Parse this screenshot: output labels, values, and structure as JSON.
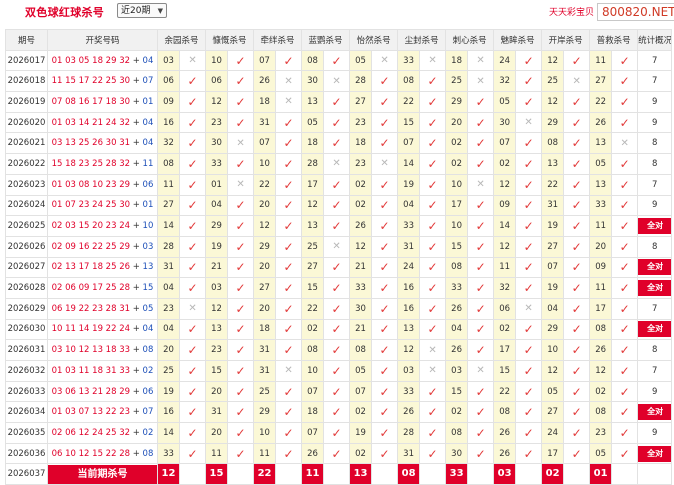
{
  "header": {
    "title": "双色球红球杀号",
    "period_select": "近20期",
    "brand": "天天彩宝贝",
    "watermark": "800820.NET"
  },
  "columns": [
    "期号",
    "开奖号码",
    "余园杀号",
    "慷慨杀号",
    "牵绊杀号",
    "蓝鹦杀号",
    "怡然杀号",
    "尘封杀号",
    "刺心杀号",
    "魅眸杀号",
    "开岸杀号",
    "普救杀号",
    "统计概况"
  ],
  "rows": [
    {
      "issue": "2026017",
      "red": "01 03 05 18 29 32",
      "blue": "04",
      "kills": [
        [
          "03",
          0
        ],
        [
          "10",
          1
        ],
        [
          "07",
          1
        ],
        [
          "08",
          1
        ],
        [
          "05",
          0
        ],
        [
          "33",
          0
        ],
        [
          "18",
          0
        ],
        [
          "24",
          1
        ],
        [
          "12",
          1
        ],
        [
          "11",
          1
        ]
      ],
      "stat": "7"
    },
    {
      "issue": "2026018",
      "red": "11 15 17 22 25 30",
      "blue": "07",
      "kills": [
        [
          "06",
          1
        ],
        [
          "06",
          1
        ],
        [
          "26",
          0
        ],
        [
          "30",
          0
        ],
        [
          "28",
          1
        ],
        [
          "08",
          1
        ],
        [
          "25",
          0
        ],
        [
          "32",
          1
        ],
        [
          "25",
          0
        ],
        [
          "27",
          1
        ]
      ],
      "stat": "7"
    },
    {
      "issue": "2026019",
      "red": "07 08 16 17 18 30",
      "blue": "01",
      "kills": [
        [
          "09",
          1
        ],
        [
          "12",
          1
        ],
        [
          "18",
          0
        ],
        [
          "13",
          1
        ],
        [
          "27",
          1
        ],
        [
          "22",
          1
        ],
        [
          "29",
          1
        ],
        [
          "05",
          1
        ],
        [
          "12",
          1
        ],
        [
          "22",
          1
        ]
      ],
      "stat": "9"
    },
    {
      "issue": "2026020",
      "red": "01 03 14 21 24 32",
      "blue": "04",
      "kills": [
        [
          "16",
          1
        ],
        [
          "23",
          1
        ],
        [
          "31",
          1
        ],
        [
          "05",
          1
        ],
        [
          "23",
          1
        ],
        [
          "15",
          1
        ],
        [
          "20",
          1
        ],
        [
          "30",
          0
        ],
        [
          "29",
          1
        ],
        [
          "26",
          1
        ]
      ],
      "stat": "9"
    },
    {
      "issue": "2026021",
      "red": "03 13 25 26 30 31",
      "blue": "04",
      "kills": [
        [
          "32",
          1
        ],
        [
          "30",
          0
        ],
        [
          "07",
          1
        ],
        [
          "18",
          1
        ],
        [
          "18",
          1
        ],
        [
          "07",
          1
        ],
        [
          "02",
          1
        ],
        [
          "07",
          1
        ],
        [
          "08",
          1
        ],
        [
          "13",
          0
        ]
      ],
      "stat": "8"
    },
    {
      "issue": "2026022",
      "red": "15 18 23 25 28 32",
      "blue": "11",
      "kills": [
        [
          "08",
          1
        ],
        [
          "33",
          1
        ],
        [
          "10",
          1
        ],
        [
          "28",
          0
        ],
        [
          "23",
          0
        ],
        [
          "14",
          1
        ],
        [
          "02",
          1
        ],
        [
          "02",
          1
        ],
        [
          "13",
          1
        ],
        [
          "05",
          1
        ]
      ],
      "stat": "8"
    },
    {
      "issue": "2026023",
      "red": "01 03 08 10 23 29",
      "blue": "06",
      "kills": [
        [
          "11",
          1
        ],
        [
          "01",
          0
        ],
        [
          "22",
          1
        ],
        [
          "17",
          1
        ],
        [
          "02",
          1
        ],
        [
          "19",
          1
        ],
        [
          "10",
          0
        ],
        [
          "12",
          1
        ],
        [
          "22",
          1
        ],
        [
          "13",
          1
        ]
      ],
      "stat": "7"
    },
    {
      "issue": "2026024",
      "red": "01 07 23 24 25 30",
      "blue": "01",
      "kills": [
        [
          "27",
          1
        ],
        [
          "04",
          1
        ],
        [
          "20",
          1
        ],
        [
          "12",
          1
        ],
        [
          "02",
          1
        ],
        [
          "04",
          1
        ],
        [
          "17",
          1
        ],
        [
          "09",
          1
        ],
        [
          "31",
          1
        ],
        [
          "33",
          1
        ]
      ],
      "stat": "9"
    },
    {
      "issue": "2026025",
      "red": "02 03 15 20 23 24",
      "blue": "10",
      "kills": [
        [
          "14",
          1
        ],
        [
          "29",
          1
        ],
        [
          "12",
          1
        ],
        [
          "13",
          1
        ],
        [
          "26",
          1
        ],
        [
          "33",
          1
        ],
        [
          "10",
          1
        ],
        [
          "14",
          1
        ],
        [
          "19",
          1
        ],
        [
          "11",
          1
        ]
      ],
      "stat": "全对"
    },
    {
      "issue": "2026026",
      "red": "02 09 16 22 25 29",
      "blue": "03",
      "kills": [
        [
          "28",
          1
        ],
        [
          "19",
          1
        ],
        [
          "29",
          1
        ],
        [
          "25",
          0
        ],
        [
          "12",
          1
        ],
        [
          "31",
          1
        ],
        [
          "15",
          1
        ],
        [
          "12",
          1
        ],
        [
          "27",
          1
        ],
        [
          "20",
          1
        ]
      ],
      "stat": "8"
    },
    {
      "issue": "2026027",
      "red": "02 13 17 18 25 26",
      "blue": "13",
      "kills": [
        [
          "31",
          1
        ],
        [
          "21",
          1
        ],
        [
          "20",
          1
        ],
        [
          "27",
          1
        ],
        [
          "21",
          1
        ],
        [
          "24",
          1
        ],
        [
          "08",
          1
        ],
        [
          "11",
          1
        ],
        [
          "07",
          1
        ],
        [
          "09",
          1
        ]
      ],
      "stat": "全对"
    },
    {
      "issue": "2026028",
      "red": "02 06 09 17 25 28",
      "blue": "15",
      "kills": [
        [
          "04",
          1
        ],
        [
          "03",
          1
        ],
        [
          "27",
          1
        ],
        [
          "15",
          1
        ],
        [
          "33",
          1
        ],
        [
          "16",
          1
        ],
        [
          "33",
          1
        ],
        [
          "32",
          1
        ],
        [
          "19",
          1
        ],
        [
          "11",
          1
        ]
      ],
      "stat": "全对"
    },
    {
      "issue": "2026029",
      "red": "06 19 22 23 28 31",
      "blue": "05",
      "kills": [
        [
          "23",
          0
        ],
        [
          "12",
          1
        ],
        [
          "20",
          1
        ],
        [
          "22",
          1
        ],
        [
          "30",
          1
        ],
        [
          "16",
          1
        ],
        [
          "26",
          1
        ],
        [
          "06",
          0
        ],
        [
          "04",
          1
        ],
        [
          "17",
          1
        ]
      ],
      "stat": "7"
    },
    {
      "issue": "2026030",
      "red": "10 11 14 19 22 24",
      "blue": "04",
      "kills": [
        [
          "04",
          1
        ],
        [
          "13",
          1
        ],
        [
          "18",
          1
        ],
        [
          "02",
          1
        ],
        [
          "21",
          1
        ],
        [
          "13",
          1
        ],
        [
          "04",
          1
        ],
        [
          "02",
          1
        ],
        [
          "29",
          1
        ],
        [
          "08",
          1
        ]
      ],
      "stat": "全对"
    },
    {
      "issue": "2026031",
      "red": "03 10 12 13 18 33",
      "blue": "08",
      "kills": [
        [
          "20",
          1
        ],
        [
          "23",
          1
        ],
        [
          "31",
          1
        ],
        [
          "08",
          1
        ],
        [
          "08",
          1
        ],
        [
          "12",
          0
        ],
        [
          "26",
          1
        ],
        [
          "17",
          1
        ],
        [
          "10",
          1
        ],
        [
          "26",
          1
        ]
      ],
      "stat": "8"
    },
    {
      "issue": "2026032",
      "red": "01 03 11 18 31 33",
      "blue": "02",
      "kills": [
        [
          "25",
          1
        ],
        [
          "15",
          1
        ],
        [
          "31",
          0
        ],
        [
          "10",
          1
        ],
        [
          "05",
          1
        ],
        [
          "03",
          0
        ],
        [
          "03",
          0
        ],
        [
          "15",
          1
        ],
        [
          "12",
          1
        ],
        [
          "12",
          1
        ]
      ],
      "stat": "7"
    },
    {
      "issue": "2026033",
      "red": "03 06 13 21 28 29",
      "blue": "06",
      "kills": [
        [
          "19",
          1
        ],
        [
          "20",
          1
        ],
        [
          "25",
          1
        ],
        [
          "07",
          1
        ],
        [
          "07",
          1
        ],
        [
          "33",
          1
        ],
        [
          "15",
          1
        ],
        [
          "22",
          1
        ],
        [
          "05",
          1
        ],
        [
          "02",
          1
        ]
      ],
      "stat": "9"
    },
    {
      "issue": "2026034",
      "red": "01 03 07 13 22 23",
      "blue": "07",
      "kills": [
        [
          "16",
          1
        ],
        [
          "31",
          1
        ],
        [
          "29",
          1
        ],
        [
          "18",
          1
        ],
        [
          "02",
          1
        ],
        [
          "26",
          1
        ],
        [
          "02",
          1
        ],
        [
          "08",
          1
        ],
        [
          "27",
          1
        ],
        [
          "08",
          1
        ]
      ],
      "stat": "全对"
    },
    {
      "issue": "2026035",
      "red": "02 06 12 24 25 32",
      "blue": "02",
      "kills": [
        [
          "14",
          1
        ],
        [
          "20",
          1
        ],
        [
          "10",
          1
        ],
        [
          "07",
          1
        ],
        [
          "19",
          1
        ],
        [
          "28",
          1
        ],
        [
          "08",
          1
        ],
        [
          "26",
          1
        ],
        [
          "24",
          1
        ],
        [
          "23",
          1
        ]
      ],
      "stat": "9"
    },
    {
      "issue": "2026036",
      "red": "06 10 12 15 22 28",
      "blue": "08",
      "kills": [
        [
          "33",
          1
        ],
        [
          "11",
          1
        ],
        [
          "11",
          1
        ],
        [
          "26",
          1
        ],
        [
          "02",
          1
        ],
        [
          "31",
          1
        ],
        [
          "30",
          1
        ],
        [
          "26",
          1
        ],
        [
          "17",
          1
        ],
        [
          "05",
          1
        ]
      ],
      "stat": "全对"
    }
  ],
  "current": {
    "issue": "2026037",
    "label": "当前期杀号",
    "kills": [
      "12",
      "15",
      "22",
      "11",
      "13",
      "08",
      "33",
      "03",
      "02",
      "01"
    ]
  }
}
